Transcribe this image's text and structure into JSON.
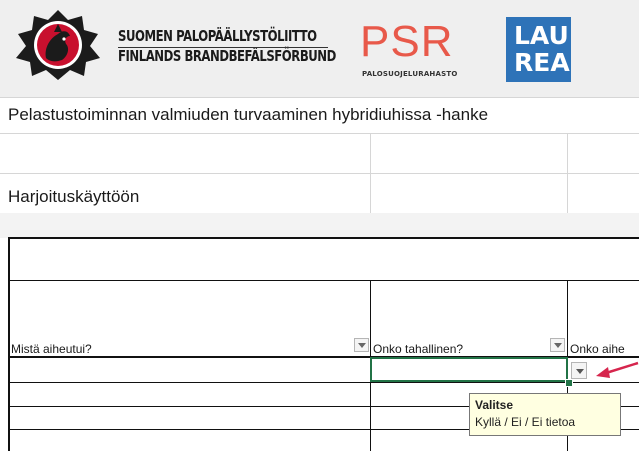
{
  "logos": {
    "spl": {
      "line1": "SUOMEN PALOPÄÄLLYSTÖLIITTO",
      "line2": "FINLANDS BRANDBEFÄLSFÖRBUND",
      "emblem_color": "#c8102e"
    },
    "psr": {
      "word": "PSR",
      "subtitle": "PALOSUOJELURAHASTO",
      "color": "#e8594a"
    },
    "laurea": {
      "line1": "LAU",
      "line2": "REA",
      "color": "#2e73b8"
    }
  },
  "sheet": {
    "project_title": "Pelastustoiminnan valmiuden turvaaminen hybridiuhissa -hanke",
    "practice_label": "Harjoituskäyttöön",
    "columns": [
      {
        "label": "Mistä aiheutui?"
      },
      {
        "label": "Onko tahallinen?"
      },
      {
        "label": "Onko aihe"
      }
    ],
    "filter_icon": "dropdown-arrow-icon",
    "selection_color": "#217346"
  },
  "tooltip": {
    "title": "Valitse",
    "body": "Kyllä / Ei / Ei tietoa"
  },
  "annotation": {
    "arrow_color": "#d6254d"
  }
}
